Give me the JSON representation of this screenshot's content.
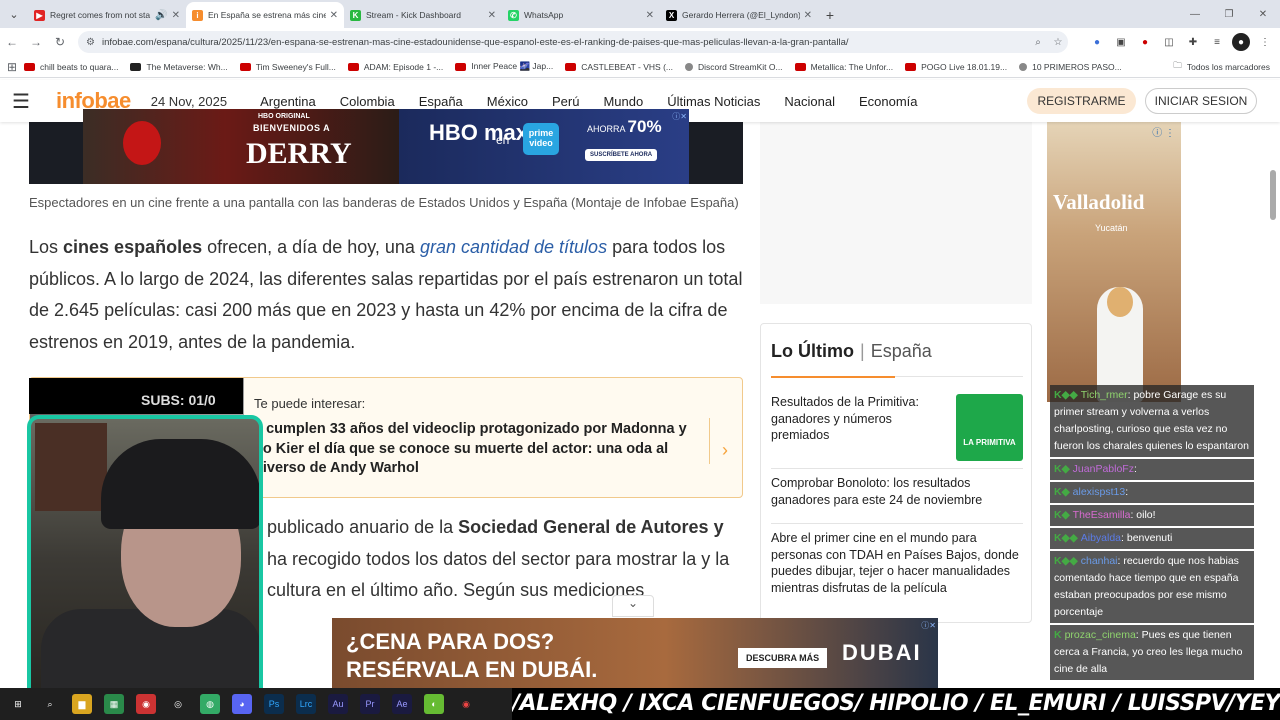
{
  "browser": {
    "tabs": [
      {
        "title": "Regret comes from not sta",
        "favcolor": "#e02424"
      },
      {
        "title": "En España se estrena más cine",
        "favcolor": "#f68d2e"
      },
      {
        "title": "Stream - Kick Dashboard",
        "favcolor": "#28b840"
      },
      {
        "title": "WhatsApp",
        "favcolor": "#25d366"
      },
      {
        "title": "Gerardo Herrera (@El_Lyndon)",
        "favcolor": "#000000"
      }
    ],
    "url": "infobae.com/espana/cultura/2025/11/23/en-espana-se-estrenan-mas-cine-estadounidense-que-espanol-este-es-el-ranking-de-paises-que-mas-peliculas-llevan-a-la-gran-pantalla/",
    "bookmarks": [
      "chill beats to quara...",
      "The Metaverse: Wh...",
      "Tim Sweeney's Full...",
      "ADAM: Episode 1 -...",
      "Inner Peace 🌌 Jap...",
      "CASTLEBEAT - VHS (...",
      "Discord StreamKit O...",
      "Metallica: The Unfor...",
      "POGO Live 18.01.19...",
      "10 PRIMEROS PASO..."
    ],
    "bookmarks_all": "Todos los marcadores"
  },
  "site": {
    "logo": "infobae",
    "date": "24 Nov, 2025",
    "nav": [
      "Argentina",
      "Colombia",
      "España",
      "México",
      "Perú",
      "Mundo",
      "Últimas Noticias",
      "Nacional",
      "Economía"
    ],
    "register": "REGISTRARME",
    "login": "INICIAR SESION"
  },
  "ads": {
    "hbo": {
      "original": "HBO ORIGINAL",
      "welcome": "BIENVENIDOS A",
      "derry": "DERRY",
      "hbomax": "HBO max",
      "en": "en",
      "primevideo": "prime video",
      "ahorra": "AHORRA",
      "pct": "70%",
      "suscribete": "SUSCRÍBETE AHORA"
    },
    "valladolid": {
      "title": "Valladolid",
      "subtitle": "Yucatán"
    },
    "dubai": {
      "line1": "¿CENA PARA DOS?",
      "line2": "RESÉRVALA EN DUBÁI.",
      "cta": "DESCUBRA MÁS",
      "brand": "DUBAI"
    }
  },
  "article": {
    "caption": "Espectadores en un cine frente a una pantalla con las banderas de Estados Unidos y España (Montaje de Infobae España)",
    "para1": {
      "a": "Los ",
      "b": "cines españoles",
      "c": " ofrecen, a día de hoy, una ",
      "link": "gran cantidad de títulos",
      "d": " para todos los públicos. A lo largo de 2024, las diferentes salas repartidas por el país estrenaron un total de 2.645 películas: casi 200 más que en 2023 y hasta un 42% por encima de la cifra de estrenos en 2019, antes de la pandemia."
    },
    "related": {
      "kicker": "Te puede interesar:",
      "title": "e cumplen 33 años del videoclip protagonizado por Madonna y do Kier el día que se conoce su muerte del actor: una oda al niverso de Andy Warhol"
    },
    "para2": {
      "a": "publicado anuario de la ",
      "b": "Sociedad General de Autores y",
      "c": " ha recogido todos los datos del sector para mostrar la y la cultura en el último año. Según sus mediciones"
    }
  },
  "latest": {
    "title": "Lo Último",
    "region": "España",
    "items": [
      "Resultados de la Primitiva: ganadores y números premiados",
      "Comprobar Bonoloto: los resultados ganadores para este 24 de noviembre",
      "Abre el primer cine en el mundo para personas con TDAH en Países Bajos, donde puedes dibujar, tejer o hacer manualidades mientras disfrutas de la película"
    ],
    "primitiva": "LA PRIMITIVA"
  },
  "chat": [
    {
      "user": "Tich_rmer",
      "text": ": pobre Garage es su primer stream y volverna a verlos charlposting, curioso que esta vez no fueron los charales quienes lo espantaron"
    },
    {
      "user": "JuanPabloFz",
      "text": ":"
    },
    {
      "user": "alexispst13",
      "text": ":"
    },
    {
      "user": "TheEsamilla",
      "text": ": oilo!"
    },
    {
      "user": "Aibyalda",
      "text": ": benvenuti"
    },
    {
      "user": "chanhai",
      "text": ": recuerdo que nos habias comentado hace tiempo que en españa estaban preocupados por ese mismo porcentaje"
    },
    {
      "user": "prozac_cinema",
      "text": ": Pues es que tienen cerca a Francia, yo creo les llega mucho cine de alla"
    }
  ],
  "stream": {
    "subs": "SUBS: 01/0",
    "ticker": "/ALEXHQ / IXCA CIENFUEGOS/ HIPOLIO / EL_EMURI / LUISSPV/YEYO121/COLINLUIS/MASSWOLF"
  }
}
